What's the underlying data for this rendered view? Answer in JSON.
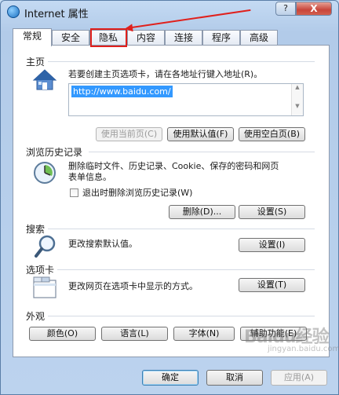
{
  "window": {
    "title": "Internet 属性",
    "help_label": "?",
    "close_label": "X"
  },
  "tabs": [
    {
      "label": "常规",
      "active": true
    },
    {
      "label": "安全"
    },
    {
      "label": "隐私"
    },
    {
      "label": "内容"
    },
    {
      "label": "连接"
    },
    {
      "label": "程序"
    },
    {
      "label": "高级"
    }
  ],
  "home": {
    "title": "主页",
    "description": "若要创建主页选项卡，请在各地址行键入地址(R)。",
    "url_value": "http://www.baidu.com/",
    "btn_current": "使用当前页(C)",
    "btn_default": "使用默认值(F)",
    "btn_blank": "使用空白页(B)"
  },
  "history": {
    "title": "浏览历史记录",
    "description_line1": "删除临时文件、历史记录、Cookie、保存的密码和网页",
    "description_line2": "表单信息。",
    "checkbox_label": "退出时删除浏览历史记录(W)",
    "btn_delete": "删除(D)...",
    "btn_settings": "设置(S)"
  },
  "search": {
    "title": "搜索",
    "description": "更改搜索默认值。",
    "btn_settings": "设置(I)"
  },
  "tabs_section": {
    "title": "选项卡",
    "description": "更改网页在选项卡中显示的方式。",
    "btn_settings": "设置(T)"
  },
  "appearance": {
    "title": "外观",
    "btn_colors": "颜色(O)",
    "btn_languages": "语言(L)",
    "btn_fonts": "字体(N)",
    "btn_accessibility": "辅助功能(E)"
  },
  "footer": {
    "ok": "确定",
    "cancel": "取消",
    "apply": "应用(A)"
  },
  "watermark": {
    "main": "Baidu经验",
    "sub": "jingyan.baidu.com"
  }
}
